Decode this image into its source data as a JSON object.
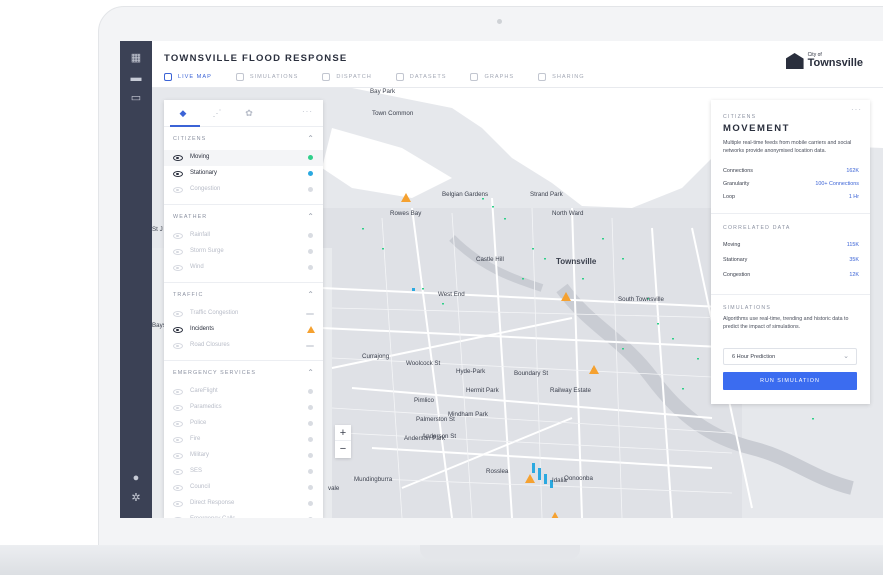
{
  "app": {
    "title": "TOWNSVILLE FLOOD RESPONSE",
    "more": "···"
  },
  "tabs": [
    {
      "label": "LIVE MAP",
      "icon": "binoculars-icon"
    },
    {
      "label": "SIMULATIONS",
      "icon": "clock-icon"
    },
    {
      "label": "DISPATCH",
      "icon": "code-icon"
    },
    {
      "label": "DATASETS",
      "icon": "layers-icon"
    },
    {
      "label": "GRAPHS",
      "icon": "refresh-icon"
    },
    {
      "label": "SHARING",
      "icon": "share-icon"
    }
  ],
  "logo": {
    "small": "City of",
    "big": "Townsville"
  },
  "panel": {
    "more": "···",
    "sections": [
      {
        "title": "CITIZENS",
        "layers": [
          {
            "label": "Moving",
            "on": true,
            "indicator": "green"
          },
          {
            "label": "Stationary",
            "on": true,
            "indicator": "blue"
          },
          {
            "label": "Congestion",
            "on": false,
            "indicator": "grey"
          }
        ]
      },
      {
        "title": "WEATHER",
        "layers": [
          {
            "label": "Rainfall",
            "on": false,
            "indicator": "grey"
          },
          {
            "label": "Storm Surge",
            "on": false,
            "indicator": "grey"
          },
          {
            "label": "Wind",
            "on": false,
            "indicator": "grey"
          }
        ]
      },
      {
        "title": "TRAFFIC",
        "layers": [
          {
            "label": "Traffic Congestion",
            "on": false,
            "indicator": "bar"
          },
          {
            "label": "Incidents",
            "on": true,
            "indicator": "warning"
          },
          {
            "label": "Road Closures",
            "on": false,
            "indicator": "bar"
          }
        ]
      },
      {
        "title": "EMERGENCY SERVICES",
        "layers": [
          {
            "label": "CareFlight",
            "on": false,
            "indicator": "grey"
          },
          {
            "label": "Paramedics",
            "on": false,
            "indicator": "grey"
          },
          {
            "label": "Police",
            "on": false,
            "indicator": "grey"
          },
          {
            "label": "Fire",
            "on": false,
            "indicator": "grey"
          },
          {
            "label": "Military",
            "on": false,
            "indicator": "grey"
          },
          {
            "label": "SES",
            "on": false,
            "indicator": "grey"
          },
          {
            "label": "Council",
            "on": false,
            "indicator": "grey"
          },
          {
            "label": "Direct Response",
            "on": false,
            "indicator": "grey"
          },
          {
            "label": "Emergency Calls",
            "on": false,
            "indicator": "grey"
          }
        ]
      }
    ]
  },
  "zoom": {
    "in": "+",
    "out": "−"
  },
  "map": {
    "labels": [
      {
        "text": "Bay Park",
        "cls": ""
      },
      {
        "text": "Town Common",
        "cls": ""
      },
      {
        "text": "Belgian Gardens",
        "cls": ""
      },
      {
        "text": "Strand Park",
        "cls": ""
      },
      {
        "text": "Rowes Bay",
        "cls": ""
      },
      {
        "text": "North Ward",
        "cls": ""
      },
      {
        "text": "Castle Hill",
        "cls": ""
      },
      {
        "text": "Townsville",
        "cls": "big"
      },
      {
        "text": "West End",
        "cls": ""
      },
      {
        "text": "South Townsville",
        "cls": ""
      },
      {
        "text": "Currajong",
        "cls": ""
      },
      {
        "text": "Hyde-Park",
        "cls": ""
      },
      {
        "text": "Hermit Park",
        "cls": ""
      },
      {
        "text": "Railway Estate",
        "cls": ""
      },
      {
        "text": "Pimlico",
        "cls": ""
      },
      {
        "text": "Mindham Park",
        "cls": ""
      },
      {
        "text": "Anderson Park",
        "cls": ""
      },
      {
        "text": "Rosslea",
        "cls": ""
      },
      {
        "text": "Mundingburra",
        "cls": ""
      },
      {
        "text": "Idalia",
        "cls": ""
      },
      {
        "text": "Oonoonba",
        "cls": ""
      },
      {
        "text": "St J",
        "cls": ""
      },
      {
        "text": "Bayswater Rd",
        "cls": ""
      },
      {
        "text": "Woolcock St",
        "cls": ""
      },
      {
        "text": "Boundary St",
        "cls": ""
      },
      {
        "text": "Palmerston St",
        "cls": ""
      },
      {
        "text": "Anderson St",
        "cls": ""
      },
      {
        "text": "vale",
        "cls": ""
      }
    ]
  },
  "info": {
    "more": "···",
    "kicker": "CITIZENS",
    "title": "MOVEMENT",
    "description": "Multiple real-time feeds from mobile carriers and social networks provide anonymised location data.",
    "stats": [
      {
        "key": "Connections",
        "value": "162K"
      },
      {
        "key": "Granularity",
        "value": "100+ Connections"
      },
      {
        "key": "Loop",
        "value": "1 Hr"
      }
    ],
    "correlated_title": "CORRELATED DATA",
    "correlated": [
      {
        "key": "Moving",
        "value": "115K"
      },
      {
        "key": "Stationary",
        "value": "35K"
      },
      {
        "key": "Congestion",
        "value": "12K"
      }
    ],
    "sim_title": "SIMULATIONS",
    "sim_desc": "Algorithms use real-time, trending and historic data to predict the impact of simulations.",
    "select_value": "6 Hour Prediction",
    "run_label": "RUN SIMULATION"
  },
  "colors": {
    "accent": "#3b63d6",
    "rail": "#3b4155",
    "warning": "#f5a130",
    "moving": "#2fcf8a",
    "stationary": "#2ba9e0"
  }
}
